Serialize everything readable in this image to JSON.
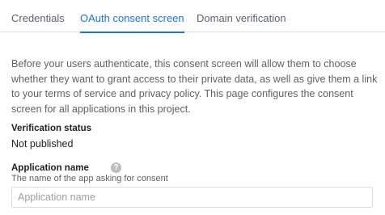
{
  "tabs": [
    {
      "label": "Credentials",
      "active": false
    },
    {
      "label": "OAuth consent screen",
      "active": true
    },
    {
      "label": "Domain verification",
      "active": false
    }
  ],
  "description": "Before your users authenticate, this consent screen will allow them to choose whether they want to grant access to their private data, as well as give them a link to your terms of service and privacy policy. This page configures the consent screen for all applications in this project.",
  "verification": {
    "label": "Verification status",
    "value": "Not published"
  },
  "application_name": {
    "label": "Application name",
    "help_icon": "help-circle-icon",
    "hint": "The name of the app asking for consent",
    "placeholder": "Application name",
    "value": ""
  },
  "colors": {
    "accent": "#1a73e8",
    "text": "#212121",
    "secondary_text": "#616161"
  }
}
